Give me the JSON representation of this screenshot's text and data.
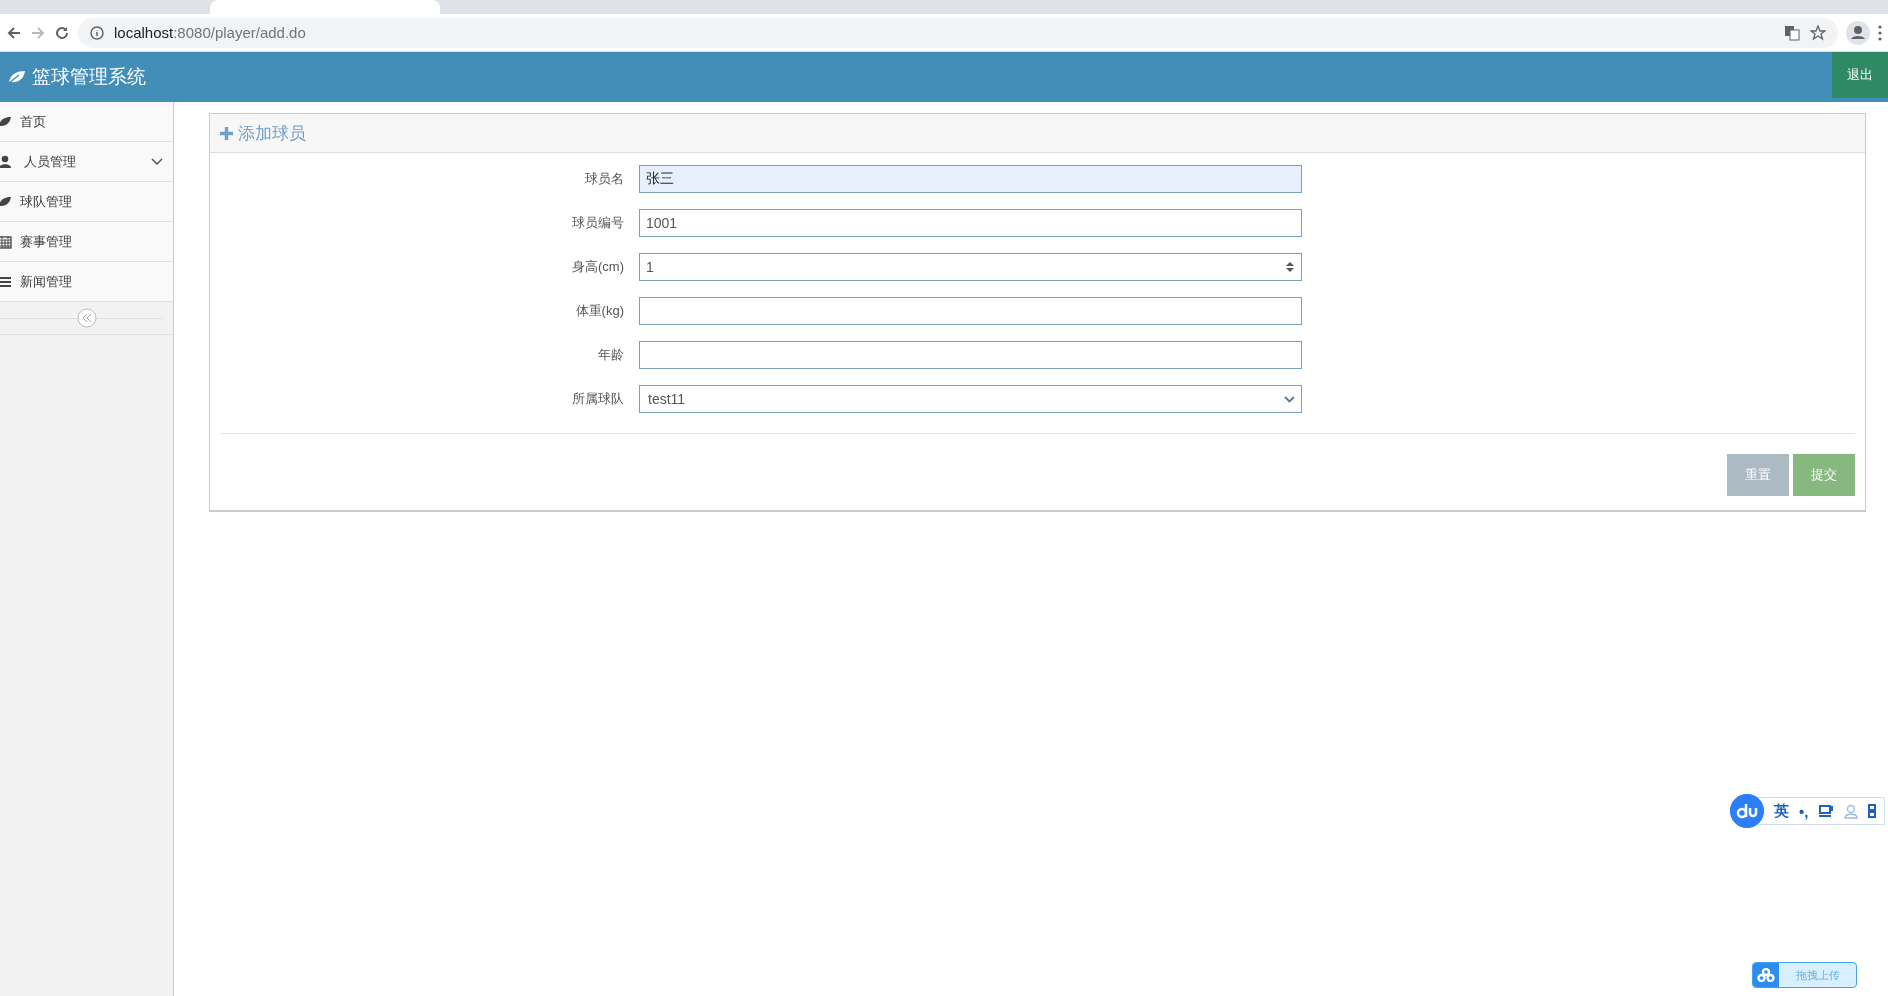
{
  "browser": {
    "url": {
      "host": "localhost",
      "path": ":8080/player/add.do"
    }
  },
  "header": {
    "title": "篮球管理系统",
    "logout": "退出"
  },
  "sidebar": {
    "items": [
      {
        "label": "首页",
        "submenu": false
      },
      {
        "label": "人员管理",
        "submenu": true
      },
      {
        "label": "球队管理",
        "submenu": false
      },
      {
        "label": "赛事管理",
        "submenu": false
      },
      {
        "label": "新闻管理",
        "submenu": false
      }
    ]
  },
  "panel": {
    "title": "添加球员",
    "fields": [
      {
        "label": "球员名",
        "kind": "text",
        "value": "张三",
        "autofilled": true
      },
      {
        "label": "球员编号",
        "kind": "text",
        "value": "1001",
        "autofilled": false
      },
      {
        "label": "身高(cm)",
        "kind": "number",
        "value": "1",
        "autofilled": false
      },
      {
        "label": "体重(kg)",
        "kind": "number",
        "autofilled": false
      },
      {
        "label": "年龄",
        "kind": "text",
        "autofilled": false
      },
      {
        "label": "所属球队",
        "kind": "select",
        "value": "test11",
        "autofilled": false
      }
    ],
    "buttons": [
      {
        "label": "重置",
        "kind": "reset"
      },
      {
        "label": "提交",
        "kind": "submit"
      }
    ]
  },
  "ime": {
    "lang": "英",
    "punct": "•,"
  },
  "upload": {
    "label": "拖拽上传"
  }
}
